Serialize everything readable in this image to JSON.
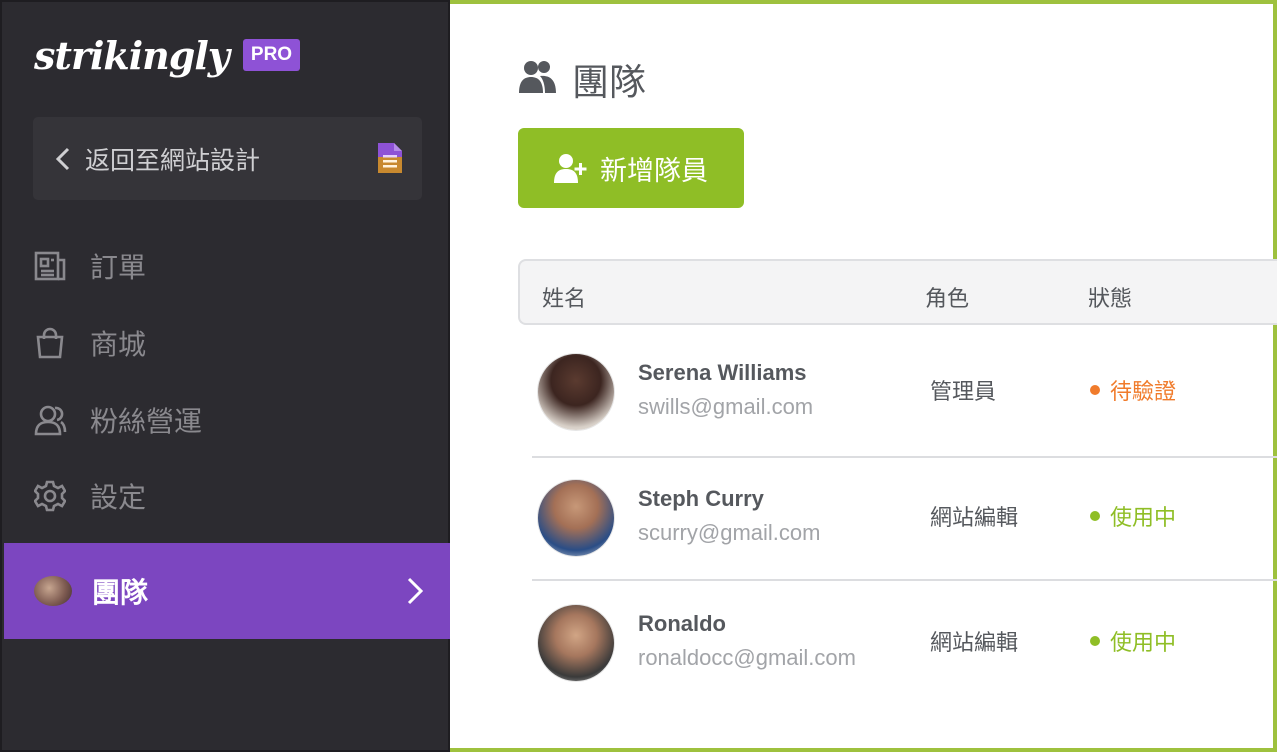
{
  "sidebar": {
    "logo": "strikingly",
    "badge": "PRO",
    "back_label": "返回至網站設計",
    "items": [
      {
        "label": "訂單",
        "icon": "newspaper-icon"
      },
      {
        "label": "商城",
        "icon": "shopping-bag-icon"
      },
      {
        "label": "粉絲營運",
        "icon": "users-icon"
      },
      {
        "label": "設定",
        "icon": "gear-icon"
      },
      {
        "label": "團隊",
        "icon": "team-avatar",
        "active": true
      }
    ]
  },
  "main": {
    "title": "團隊",
    "add_button_label": "新增隊員",
    "columns": [
      "姓名",
      "角色",
      "狀態"
    ],
    "members": [
      {
        "name": "Serena Williams",
        "email": "swills@gmail.com",
        "role": "管理員",
        "status": "待驗證",
        "status_color": "#f07b2b"
      },
      {
        "name": "Steph Curry",
        "email": "scurry@gmail.com",
        "role": "網站編輯",
        "status": "使用中",
        "status_color": "#8fbe26"
      },
      {
        "name": "Ronaldo",
        "email": "ronaldocc@gmail.com",
        "role": "網站編輯",
        "status": "使用中",
        "status_color": "#8fbe26"
      }
    ]
  },
  "colors": {
    "sidebar_bg": "#2c2b30",
    "active_purple": "#7c46c0",
    "badge_purple": "#8e52d6",
    "accent_green": "#8fbe26",
    "pending_orange": "#f07b2b"
  }
}
